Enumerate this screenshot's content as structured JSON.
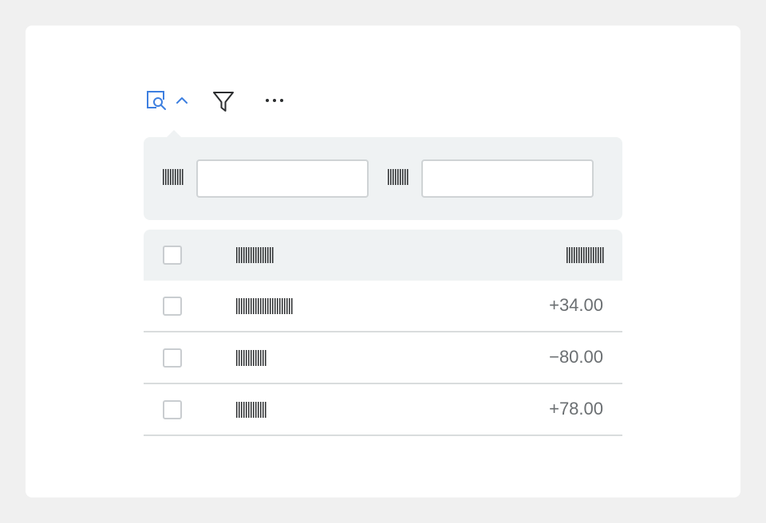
{
  "toolbar": {
    "icons": [
      "search-panel-icon",
      "chevron-up-icon",
      "filter-icon",
      "more-icon"
    ],
    "accent_color": "#3d7fe0"
  },
  "filter_panel": {
    "fields": [
      {
        "label_redacted": true,
        "value": ""
      },
      {
        "label_redacted": true,
        "value": ""
      }
    ]
  },
  "table": {
    "header": {
      "name_redacted": true,
      "amount_redacted": true
    },
    "rows": [
      {
        "name_redacted": true,
        "amount": "+34.00"
      },
      {
        "name_redacted": true,
        "amount": "−80.00"
      },
      {
        "name_redacted": true,
        "amount": "+78.00"
      }
    ]
  }
}
